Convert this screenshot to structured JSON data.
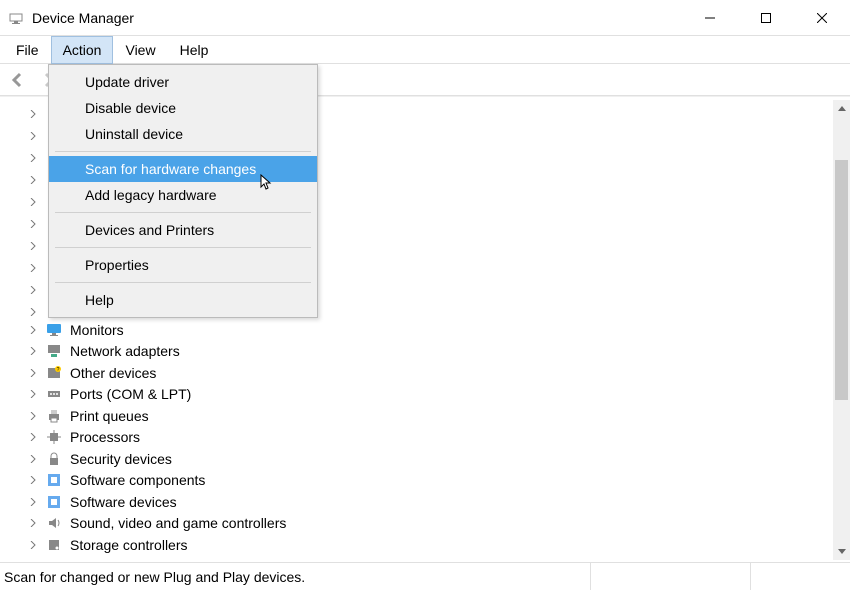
{
  "window": {
    "title": "Device Manager"
  },
  "menubar": {
    "items": [
      {
        "label": "File"
      },
      {
        "label": "Action"
      },
      {
        "label": "View"
      },
      {
        "label": "Help"
      }
    ],
    "selected_index": 1
  },
  "dropdown": {
    "items": [
      {
        "label": "Update driver"
      },
      {
        "label": "Disable device"
      },
      {
        "label": "Uninstall device"
      },
      {
        "type": "sep"
      },
      {
        "label": "Scan for hardware changes",
        "highlighted": true
      },
      {
        "label": "Add legacy hardware"
      },
      {
        "type": "sep"
      },
      {
        "label": "Devices and Printers"
      },
      {
        "type": "sep"
      },
      {
        "label": "Properties"
      },
      {
        "type": "sep"
      },
      {
        "label": "Help"
      }
    ]
  },
  "tree": {
    "visible_items": [
      {
        "label": "Monitors",
        "icon": "monitor"
      },
      {
        "label": "Network adapters",
        "icon": "network"
      },
      {
        "label": "Other devices",
        "icon": "other"
      },
      {
        "label": "Ports (COM & LPT)",
        "icon": "ports"
      },
      {
        "label": "Print queues",
        "icon": "printer"
      },
      {
        "label": "Processors",
        "icon": "cpu"
      },
      {
        "label": "Security devices",
        "icon": "security"
      },
      {
        "label": "Software components",
        "icon": "software"
      },
      {
        "label": "Software devices",
        "icon": "software"
      },
      {
        "label": "Sound, video and game controllers",
        "icon": "sound"
      },
      {
        "label": "Storage controllers",
        "icon": "storage"
      }
    ]
  },
  "statusbar": {
    "text": "Scan for changed or new Plug and Play devices."
  }
}
